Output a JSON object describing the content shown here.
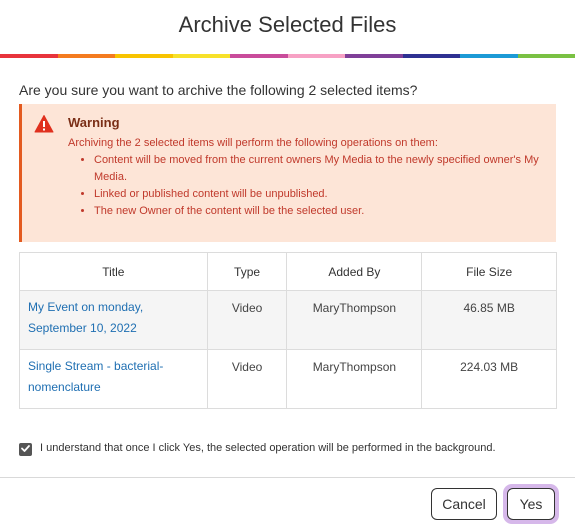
{
  "dialog": {
    "title": "Archive Selected Files",
    "stripe_colors": [
      "#e8343c",
      "#f47b20",
      "#f8c400",
      "#f7e12a",
      "#c94c9b",
      "#f7a1c4",
      "#7f3f98",
      "#2e3192",
      "#1c9ad6",
      "#7ac143"
    ],
    "question": "Are you sure you want to archive the following 2 selected items?"
  },
  "warning": {
    "icon": "warning-triangle-icon",
    "title": "Warning",
    "description": "Archiving the 2 selected items will perform the following operations on them:",
    "items": [
      "Content will be moved from the current owners My Media to the newly specified owner's My Media.",
      "Linked or published content will be unpublished.",
      "The new Owner of the content will be the selected user."
    ],
    "bg_color": "#fde5d7",
    "accent_color": "#e35a1f"
  },
  "table": {
    "headers": [
      "Title",
      "Type",
      "Added By",
      "File Size"
    ],
    "rows": [
      {
        "title": "My Event on monday, September 10, 2022",
        "type": "Video",
        "added_by": "MaryThompson",
        "size": "46.85 MB"
      },
      {
        "title": "Single Stream - bacterial-nomenclature",
        "type": "Video",
        "added_by": "MaryThompson",
        "size": "224.03 MB"
      }
    ]
  },
  "confirm": {
    "checked": true,
    "label": "I understand that once I click Yes, the selected operation will be performed in the background."
  },
  "buttons": {
    "cancel": "Cancel",
    "yes": "Yes",
    "focus_ring_color": "#d6b8ea"
  }
}
